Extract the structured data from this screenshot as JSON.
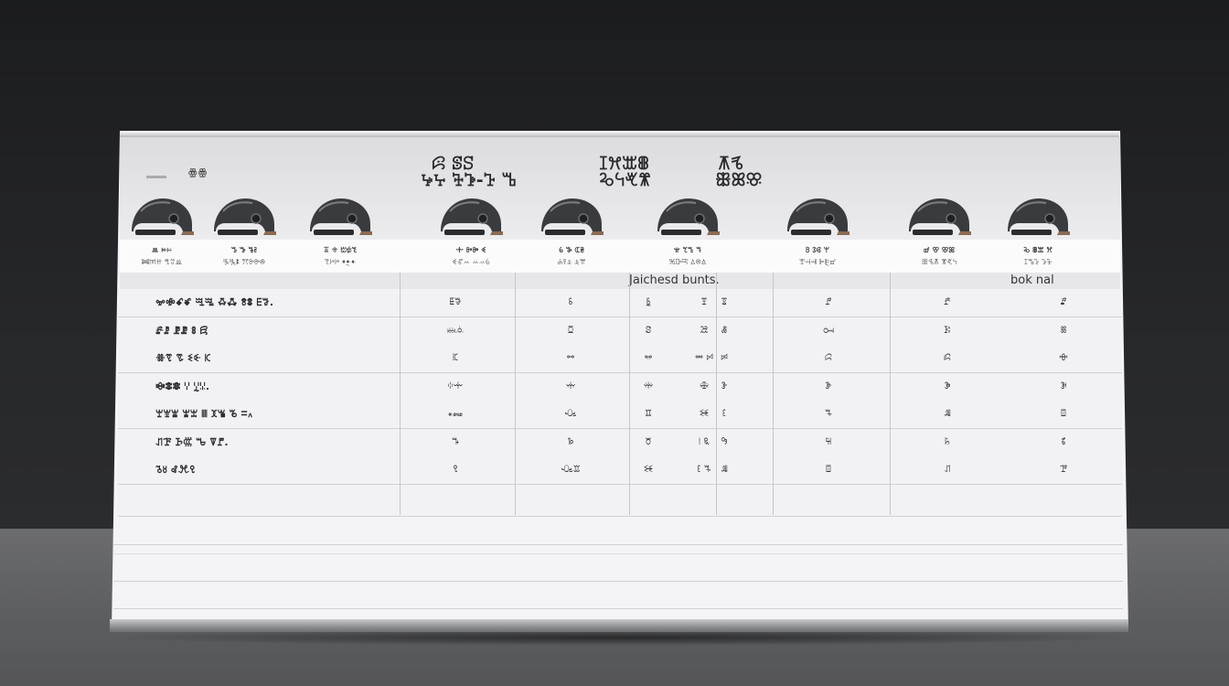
{
  "header": {
    "mark": "ꙮꙮ",
    "title_lines_left": [
      "ꕸ ꕷꕶ",
      "ꕵꕴ ꕳꕲ-ꕱ ꕰ"
    ],
    "title_lines_mid": [
      "ꕯꕮꕭꕬ",
      "ꕫꕪꕩꕨ"
    ],
    "title_lines_right": [
      "ꕧꕦ",
      "ꕥꕤꕣ"
    ]
  },
  "helmets": [
    {
      "icon": "helmet-icon",
      "l1": "ꔛ ꔜꔝ",
      "l2": "ꔞꔟꔠ ꔡꔢꔣ"
    },
    {
      "icon": "helmet-icon",
      "l1": "ꔤ ꔥ ꔦꔧ",
      "l2": "ꔨꔩꔪ ꔫꔬꔭꔮ"
    },
    {
      "icon": "helmet-icon",
      "l1": "ꔯ ꔰ ꔱꔲꔳ",
      "l2": "ꔴꔵꔶ ꔷꔸꔹ"
    },
    {
      "icon": "helmet-icon",
      "l1": "ꔺ ꔻꔼ ꔽ",
      "l2": "ꔾꔿꕀ ꕁꕂꕃ"
    },
    {
      "icon": "helmet-icon",
      "l1": "ꕄ ꕅ ꕆꕇ",
      "l2": "ꕈꕉꕊ ꕋꕌ"
    },
    {
      "icon": "helmet-icon",
      "l1": "ꕍ ꕎꕏ ꕐ",
      "l2": "ꕑꕒꕓ ꕔꕕꕖ"
    },
    {
      "icon": "helmet-icon",
      "l1": "ꕗ ꕘꕙ ꕚ",
      "l2": "ꕛꕜꕝ ꕞꕟꕠ"
    },
    {
      "icon": "helmet-icon",
      "l1": "ꕡ ꕢ ꕣꕤ",
      "l2": "ꕥꕦꕧ ꕨꕩꕪ"
    },
    {
      "icon": "helmet-icon",
      "l1": "ꕫ ꕬꕭ ꕮ",
      "l2": "ꕯꕰꕱ ꕲꕳ"
    }
  ],
  "table": {
    "subheader_mid": "Jaichesd bunts.",
    "subheader_right": "bok nal",
    "rows": [
      {
        "label": "ꗁꗂꗃꗄ ꗅꗆ ꗇꗈ ꗉꗊ ꗋꗌ.",
        "cells": [
          "ꗍꗎ",
          "ꗏ",
          "ꗐ",
          "ꗑ",
          "ꗒ",
          "ꗓ",
          "ꗔ",
          "ꗕ"
        ]
      },
      {
        "label": "ꗖꗗ ꗘꗙ ꗚ ꗛ",
        "cells": [
          "ꗜꗝ",
          "ꗞ",
          "ꗟ",
          "ꗠ",
          "ꗡ",
          "ꗢ",
          "ꗣ",
          "ꗤ"
        ]
      },
      {
        "label": "ꗥꗦ ꗧ ꗨꗩ ꗪ",
        "cells": [
          "ꗫ",
          "ꗬ",
          "ꗭ",
          "ꗮ ꗯ",
          "ꗰ",
          "ꗱ",
          "ꗲ",
          "ꗳ"
        ]
      },
      {
        "label": "ꗴꗵꗶ ꗷ ꗸꗹ.",
        "cells": [
          "ꗺꗻ",
          "ꗼ",
          "ꗽ",
          "ꗾ",
          "ꗿ",
          "ꘀ",
          "ꘁ",
          "ꘂ"
        ]
      },
      {
        "label": "ꘃꘄꘅ ꘆꘇ ꘈ ꘉꘊ ꘋ ꘌ꘍",
        "cells": [
          "꘎꘏",
          "ꘐ",
          "ꘑ",
          "ꘒ",
          "ꘓ",
          "ꘔ",
          "ꘕ",
          "ꘖ"
        ]
      },
      {
        "label": "ꘗꘘ ꘙꘚ ꘛ ꘜꘝ.",
        "cells": [
          "ꘞ",
          "ꘟ",
          "꘠",
          "꘡ ꘢",
          "꘣",
          "꘤",
          "꘥",
          "꘦"
        ]
      },
      {
        "label": "꘧꘨ ꘩ꘪꘫ",
        "cells": [
          "ꘫ",
          "ꘐꘑ",
          "ꘒ",
          "ꘓ ꘔ",
          "ꘕ",
          "ꘖ",
          "ꘗ",
          "ꘘ"
        ]
      }
    ]
  }
}
